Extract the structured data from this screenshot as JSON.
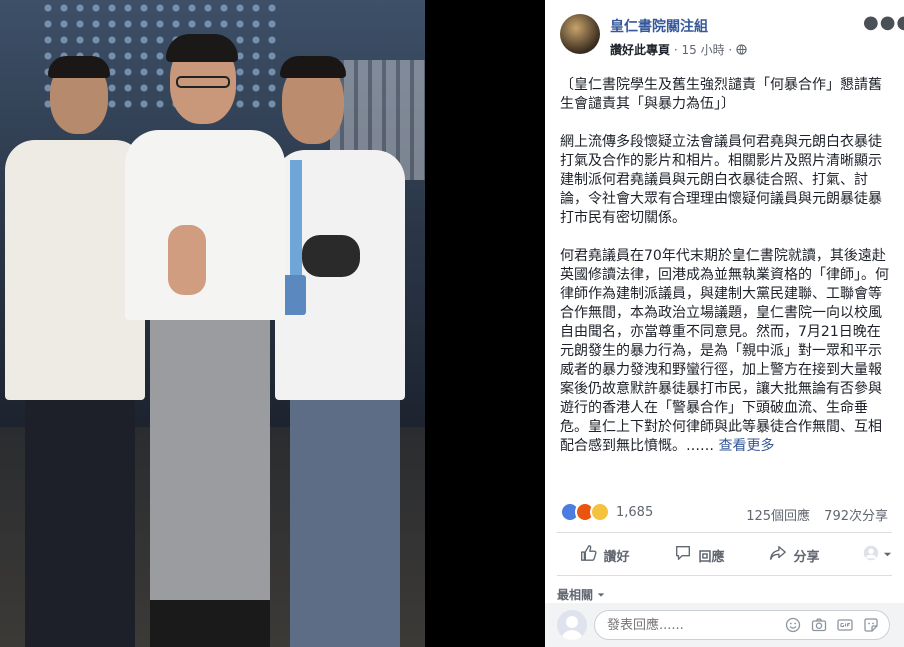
{
  "page": {
    "name": "皇仁書院關注組",
    "like_page_label": "讚好此專頁",
    "separator": "·",
    "time": "15 小時",
    "privacy_icon": "globe-icon",
    "menu_icon": "more-dots-icon"
  },
  "post": {
    "heading": "〔皇仁書院學生及舊生強烈譴責「何暴合作」懇請舊生會譴責其「與暴力為伍」〕",
    "paragraph1": "網上流傳多段懷疑立法會議員何君堯與元朗白衣暴徒打氣及合作的影片和相片。相關影片及照片清晰顯示建制派何君堯議員與元朗白衣暴徒合照、打氣、討論，令社會大眾有合理理由懷疑何議員與元朗暴徒暴打市民有密切關係。",
    "paragraph2": "何君堯議員在70年代末期於皇仁書院就讀，其後遠赴英國修讀法律，回港成為並無執業資格的「律師」。何律師作為建制派議員，與建制大黨民建聯、工聯會等合作無間，本為政治立場議題，皇仁書院一向以校風自由聞名，亦當尊重不同意見。然而，7月21日晚在元朗發生的暴力行為，是為「親中派」對一眾和平示威者的暴力發洩和野蠻行徑，加上警方在接到大量報案後仍故意默許暴徒暴打市民，讓大批無論有否參與遊行的香港人在「警暴合作」下頭破血流、生命垂危。皇仁上下對於何律師與此等暴徒合作無間、互相配合感到無比憤慨。……",
    "see_more": "查看更多"
  },
  "stats": {
    "reactions_count": "1,685",
    "comments": "125個回應",
    "shares": "792次分享",
    "reaction_colors": {
      "like": "#4b7ce0",
      "angry": "#e9540e",
      "sad": "#f4c23d"
    }
  },
  "actions": {
    "like": "讚好",
    "comment": "回應",
    "share": "分享"
  },
  "comments": {
    "sort_label": "最相關",
    "input_placeholder": "發表回應......"
  },
  "colors": {
    "link": "#365899",
    "text": "#1d2129",
    "secondary": "#616770"
  }
}
